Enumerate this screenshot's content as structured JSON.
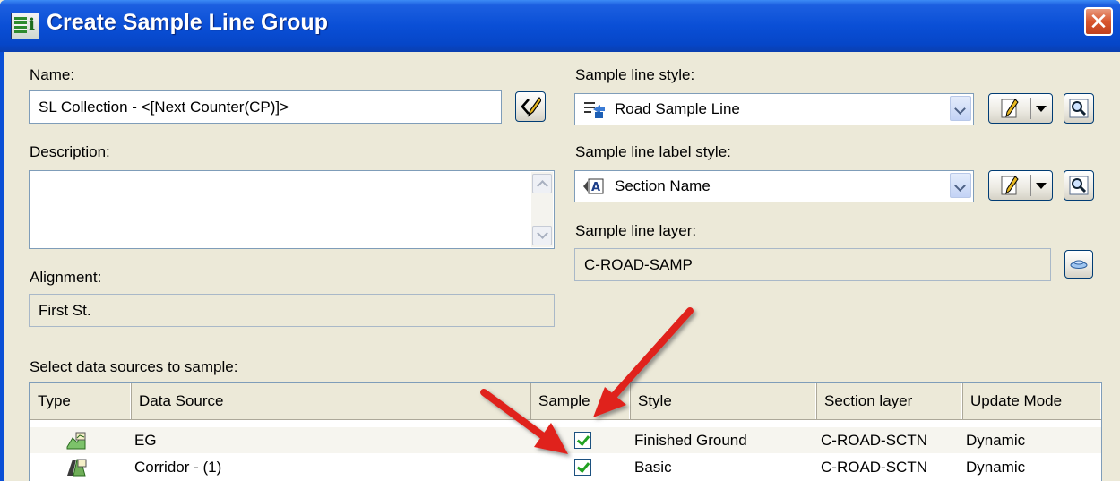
{
  "window": {
    "title": "Create Sample Line Group",
    "close_glyph": "✕"
  },
  "name": {
    "label": "Name:",
    "value": "SL Collection - <[Next Counter(CP)]>"
  },
  "description": {
    "label": "Description:",
    "value": ""
  },
  "alignment": {
    "label": "Alignment:",
    "value": "First St."
  },
  "sample_line_style": {
    "label": "Sample line style:",
    "value": "Road Sample Line",
    "icon": "sample-line-style-icon"
  },
  "sample_line_label_style": {
    "label": "Sample line label style:",
    "value": "Section Name",
    "icon": "label-style-icon"
  },
  "sample_line_layer": {
    "label": "Sample line layer:",
    "value": "C-ROAD-SAMP"
  },
  "data_sources": {
    "label": "Select data sources to sample:",
    "columns": [
      "Type",
      "Data Source",
      "Sample",
      "Style",
      "Section layer",
      "Update Mode"
    ],
    "rows": [
      {
        "type_icon": "surface-icon",
        "source": "EG",
        "sample": true,
        "style": "Finished Ground",
        "layer": "C-ROAD-SCTN",
        "mode": "Dynamic"
      },
      {
        "type_icon": "corridor-icon",
        "source": "Corridor - (1)",
        "sample": true,
        "style": "Basic",
        "layer": "C-ROAD-SCTN",
        "mode": "Dynamic"
      }
    ]
  },
  "colors": {
    "title_bar": "#0a4fd6",
    "dialog_bg": "#ece9d8",
    "close_button": "#d8572f",
    "arrow": "#e0201a"
  }
}
